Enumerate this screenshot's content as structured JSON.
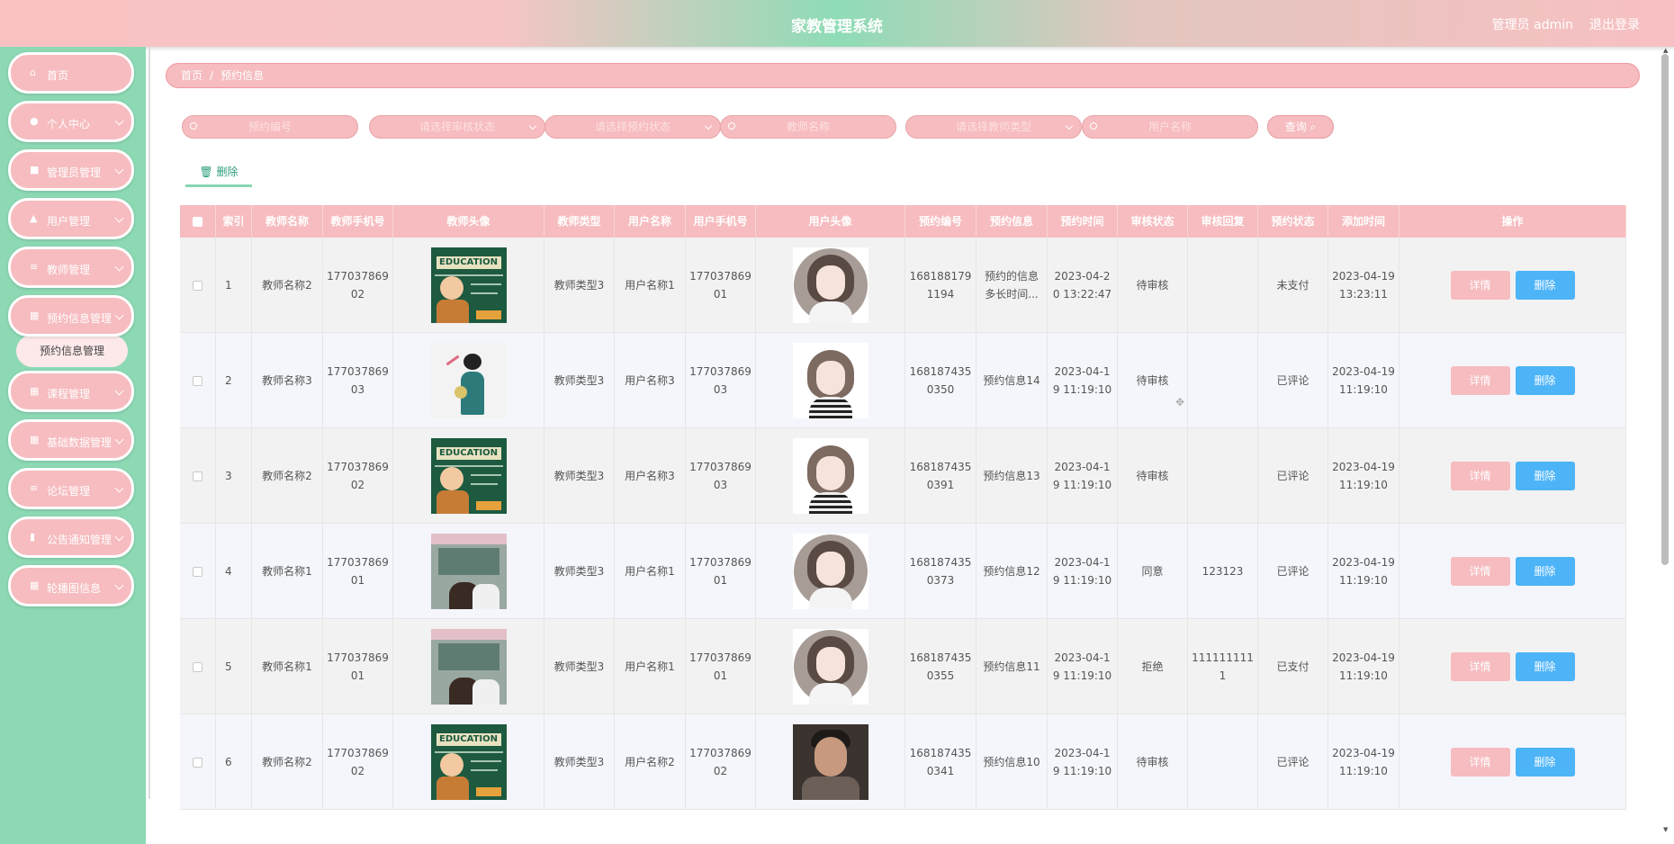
{
  "header": {
    "title": "家教管理系统",
    "user": "管理员 admin",
    "logout": "退出登录"
  },
  "sidebar": {
    "items": [
      {
        "label": "首页",
        "icon": "home-icon",
        "glyph": "⌂",
        "arrow": false
      },
      {
        "label": "个人中心",
        "icon": "user-icon",
        "glyph": "●",
        "arrow": true
      },
      {
        "label": "管理员管理",
        "icon": "chat-icon",
        "glyph": "■",
        "arrow": true
      },
      {
        "label": "用户管理",
        "icon": "thumb-icon",
        "glyph": "▲",
        "arrow": true
      },
      {
        "label": "教师管理",
        "icon": "list-icon",
        "glyph": "≡",
        "arrow": true
      },
      {
        "label": "预约信息管理",
        "icon": "grid-icon",
        "glyph": "▦",
        "arrow": true
      },
      {
        "label": "课程管理",
        "icon": "grid-icon",
        "glyph": "▦",
        "arrow": true
      },
      {
        "label": "基础数据管理",
        "icon": "grid-icon",
        "glyph": "▦",
        "arrow": true
      },
      {
        "label": "论坛管理",
        "icon": "list-icon",
        "glyph": "≡",
        "arrow": true
      },
      {
        "label": "公告通知管理",
        "icon": "bar-chart-icon",
        "glyph": "▮",
        "arrow": true
      },
      {
        "label": "轮播图信息",
        "icon": "grid-icon",
        "glyph": "▦",
        "arrow": true
      }
    ],
    "submenu": "预约信息管理"
  },
  "breadcrumb": {
    "home": "首页",
    "separator": "/",
    "current": "预约信息"
  },
  "filters": [
    {
      "placeholder": "预约编号",
      "search": true,
      "select": false
    },
    {
      "placeholder": "请选择审核状态",
      "search": false,
      "select": true
    },
    {
      "placeholder": "请选择预约状态",
      "search": false,
      "select": true
    },
    {
      "placeholder": "教师名称",
      "search": true,
      "select": false
    },
    {
      "placeholder": "请选择教师类型",
      "search": false,
      "select": true
    },
    {
      "placeholder": "用户名称",
      "search": true,
      "select": false
    }
  ],
  "query_button": "查询 ⌕",
  "delete_tab": "🗑 删除",
  "table": {
    "headers": [
      "",
      "索引",
      "教师名称",
      "教师手机号",
      "教师头像",
      "教师类型",
      "用户名称",
      "用户手机号",
      "用户头像",
      "预约编号",
      "预约信息",
      "预约时间",
      "审核状态",
      "审核回复",
      "预约状态",
      "添加时间",
      "操作"
    ],
    "detail_label": "详情",
    "delete_label": "删除",
    "rows": [
      {
        "index": "1",
        "teacher": "教师名称2",
        "tphone": "17703786902",
        "timg": "edu",
        "ttype": "教师类型3",
        "user": "用户名称1",
        "uphone": "17703786901",
        "uimg": "avatar",
        "code": "1681881791194",
        "info": "预约的信息多长时间...",
        "time": "2023-04-20 13:22:47",
        "audit": "待审核",
        "reply": "",
        "status": "未支付",
        "added": "2023-04-19 13:23:11"
      },
      {
        "index": "2",
        "teacher": "教师名称3",
        "tphone": "17703786903",
        "timg": "sketch",
        "ttype": "教师类型3",
        "user": "用户名称3",
        "uphone": "17703786903",
        "uimg": "avatar2",
        "code": "1681874350350",
        "info": "预约信息14",
        "time": "2023-04-19 11:19:10",
        "audit": "待审核",
        "reply": "",
        "status": "已评论",
        "added": "2023-04-19 11:19:10"
      },
      {
        "index": "3",
        "teacher": "教师名称2",
        "tphone": "17703786902",
        "timg": "edu",
        "ttype": "教师类型3",
        "user": "用户名称3",
        "uphone": "17703786903",
        "uimg": "avatar2",
        "code": "1681874350391",
        "info": "预约信息13",
        "time": "2023-04-19 11:19:10",
        "audit": "待审核",
        "reply": "",
        "status": "已评论",
        "added": "2023-04-19 11:19:10"
      },
      {
        "index": "4",
        "teacher": "教师名称1",
        "tphone": "17703786901",
        "timg": "class",
        "ttype": "教师类型3",
        "user": "用户名称1",
        "uphone": "17703786901",
        "uimg": "avatar",
        "code": "1681874350373",
        "info": "预约信息12",
        "time": "2023-04-19 11:19:10",
        "audit": "同意",
        "reply": "123123",
        "status": "已评论",
        "added": "2023-04-19 11:19:10"
      },
      {
        "index": "5",
        "teacher": "教师名称1",
        "tphone": "17703786901",
        "timg": "class",
        "ttype": "教师类型3",
        "user": "用户名称1",
        "uphone": "17703786901",
        "uimg": "avatar",
        "code": "1681874350355",
        "info": "预约信息11",
        "time": "2023-04-19 11:19:10",
        "audit": "拒绝",
        "reply": "1111111111",
        "status": "已支付",
        "added": "2023-04-19 11:19:10"
      },
      {
        "index": "6",
        "teacher": "教师名称2",
        "tphone": "17703786902",
        "timg": "edu",
        "ttype": "教师类型3",
        "user": "用户名称2",
        "uphone": "17703786902",
        "uimg": "photo",
        "code": "1681874350341",
        "info": "预约信息10",
        "time": "2023-04-19 11:19:10",
        "audit": "待审核",
        "reply": "",
        "status": "已评论",
        "added": "2023-04-19 11:19:10"
      }
    ]
  },
  "colors": {
    "header_pink": "#f8c2c3",
    "sidebar_green": "#8cd9b4",
    "delete_blue": "#4db4f7",
    "tab_green": "#2b9d7c"
  }
}
